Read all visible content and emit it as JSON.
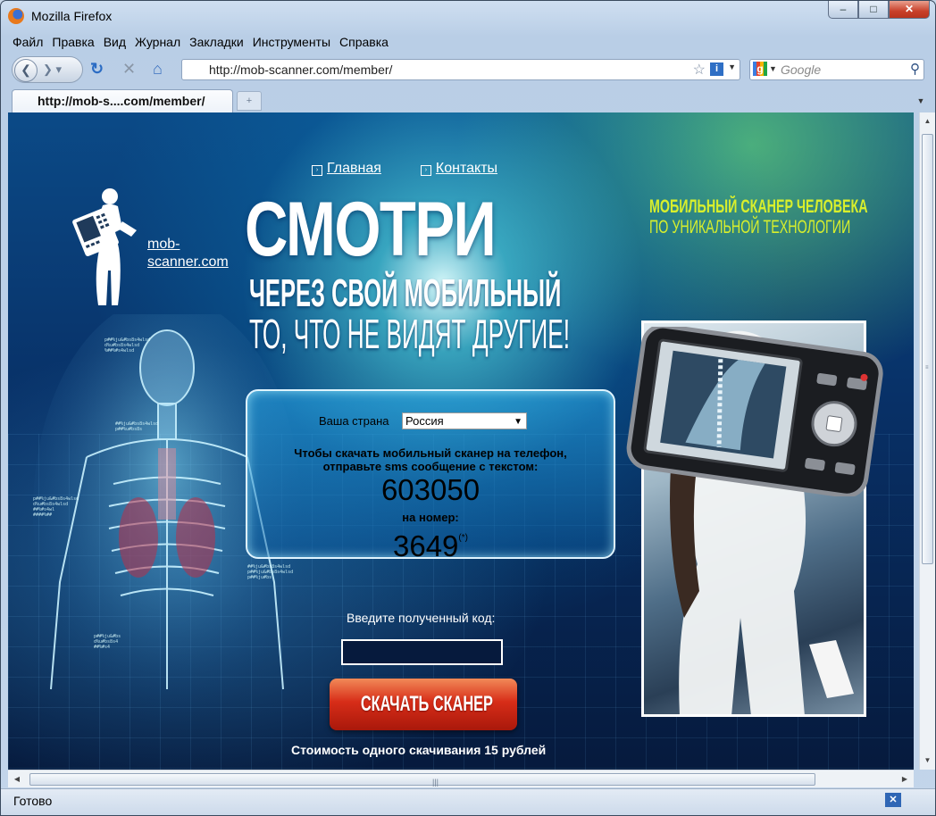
{
  "window": {
    "title": "Mozilla Firefox",
    "min": "–",
    "max": "□",
    "close": "✕"
  },
  "menu": [
    "Файл",
    "Правка",
    "Вид",
    "Журнал",
    "Закладки",
    "Инструменты",
    "Справка"
  ],
  "nav": {
    "url": "http://mob-scanner.com/member/",
    "search_placeholder": "Google"
  },
  "tab": {
    "label": "http://mob-s....com/member/",
    "new_tab": "+"
  },
  "page": {
    "links": [
      "Главная",
      "Контакты"
    ],
    "logo_text": "mob-scanner.com",
    "headline_main": "СМОТРИ",
    "headline_sub1": "ЧЕРЕЗ СВОЙ МОБИЛЬНЫЙ",
    "headline_sub2": "ТО, ЧТО НЕ ВИДЯТ ДРУГИЕ!",
    "tagline_line1": "МОБИЛЬНЫЙ СКАНЕР ЧЕЛОВЕКА",
    "tagline_line2": "ПО УНИКАЛЬНОЙ ТЕХНОЛОГИИ",
    "country_label": "Ваша страна",
    "country_value": "Россия",
    "instruction_line1": "Чтобы скачать мобильный сканер на телефон,",
    "instruction_line2": "отправьте sms сообщение с текстом:",
    "sms_code": "603050",
    "to_number_label": "на номер:",
    "short_number": "3649",
    "footnote_mark": "(*)",
    "enter_code_label": "Введите полученный код:",
    "download_button": "СКАЧАТЬ СКАНЕР",
    "cost_text": "Стоимость одного скачивания 15 рублей"
  },
  "status": {
    "text": "Готово"
  },
  "colors": {
    "accent_tagline": "#d8ef2c",
    "button_red": "#d72d18",
    "panel_cyan": "#28aaeb"
  }
}
